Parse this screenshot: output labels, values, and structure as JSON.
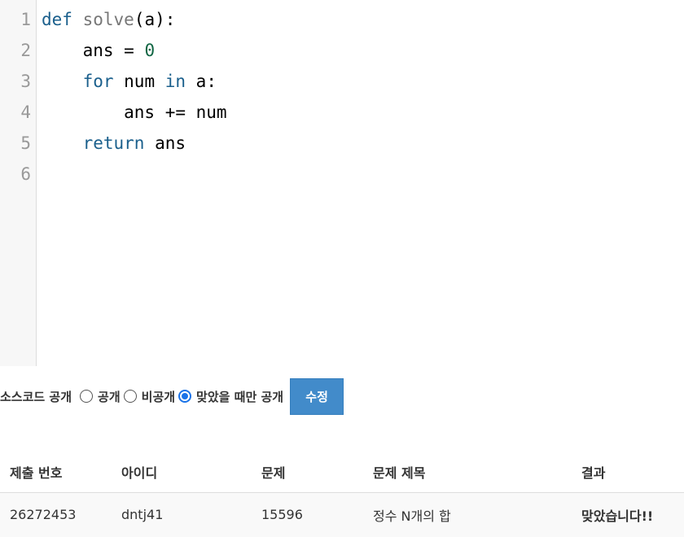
{
  "editor": {
    "line_numbers": [
      "1",
      "2",
      "3",
      "4",
      "5",
      "6"
    ],
    "lines": [
      [
        {
          "t": "def",
          "c": "kw"
        },
        {
          "t": " "
        },
        {
          "t": "solve",
          "c": "fn"
        },
        {
          "t": "(a):"
        }
      ],
      [
        {
          "t": "    ans = "
        },
        {
          "t": "0",
          "c": "num"
        }
      ],
      [
        {
          "t": "    "
        },
        {
          "t": "for",
          "c": "kw"
        },
        {
          "t": " num "
        },
        {
          "t": "in",
          "c": "kw"
        },
        {
          "t": " a:"
        }
      ],
      [
        {
          "t": "        ans += num"
        }
      ],
      [
        {
          "t": "    "
        },
        {
          "t": "return",
          "c": "kw"
        },
        {
          "t": " ans"
        }
      ],
      [
        {
          "t": ""
        }
      ]
    ]
  },
  "visibility": {
    "label": "소스코드 공개",
    "options": [
      {
        "label": "공개",
        "checked": false
      },
      {
        "label": "비공개",
        "checked": false
      },
      {
        "label": "맞았을 때만 공개",
        "checked": true
      }
    ],
    "save_label": "수정"
  },
  "submissions": {
    "headers": [
      "제출 번호",
      "아이디",
      "문제",
      "문제 제목",
      "결과"
    ],
    "rows": [
      {
        "id": "26272453",
        "user": "dntj41",
        "problem": "15596",
        "title": "정수 N개의 합",
        "result": "맞았습니다!!"
      }
    ]
  },
  "colors": {
    "keyword": "#1a5f8c",
    "function_name": "#777777",
    "number": "#116644",
    "link": "#0076c0",
    "accepted": "#009874",
    "button": "#428bca"
  }
}
